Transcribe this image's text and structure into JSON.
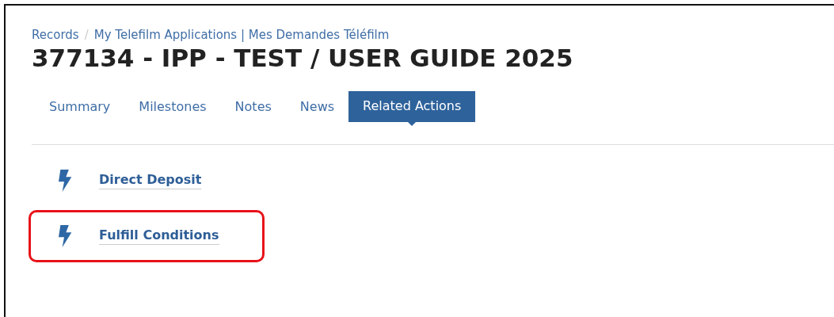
{
  "breadcrumb": [
    {
      "label": "Records"
    },
    {
      "label": "My Telefilm Applications | Mes Demandes Téléfilm"
    }
  ],
  "breadcrumb_separator": "/",
  "title": "377134 - IPP - TEST / USER GUIDE 2025",
  "tabs": [
    {
      "label": "Summary",
      "selected": false
    },
    {
      "label": "Milestones",
      "selected": false
    },
    {
      "label": "Notes",
      "selected": false
    },
    {
      "label": "News",
      "selected": false
    },
    {
      "label": "Related Actions",
      "selected": true
    }
  ],
  "actions": [
    {
      "label": "Direct Deposit",
      "highlighted": false
    },
    {
      "label": "Fulfill Conditions",
      "highlighted": true
    }
  ]
}
